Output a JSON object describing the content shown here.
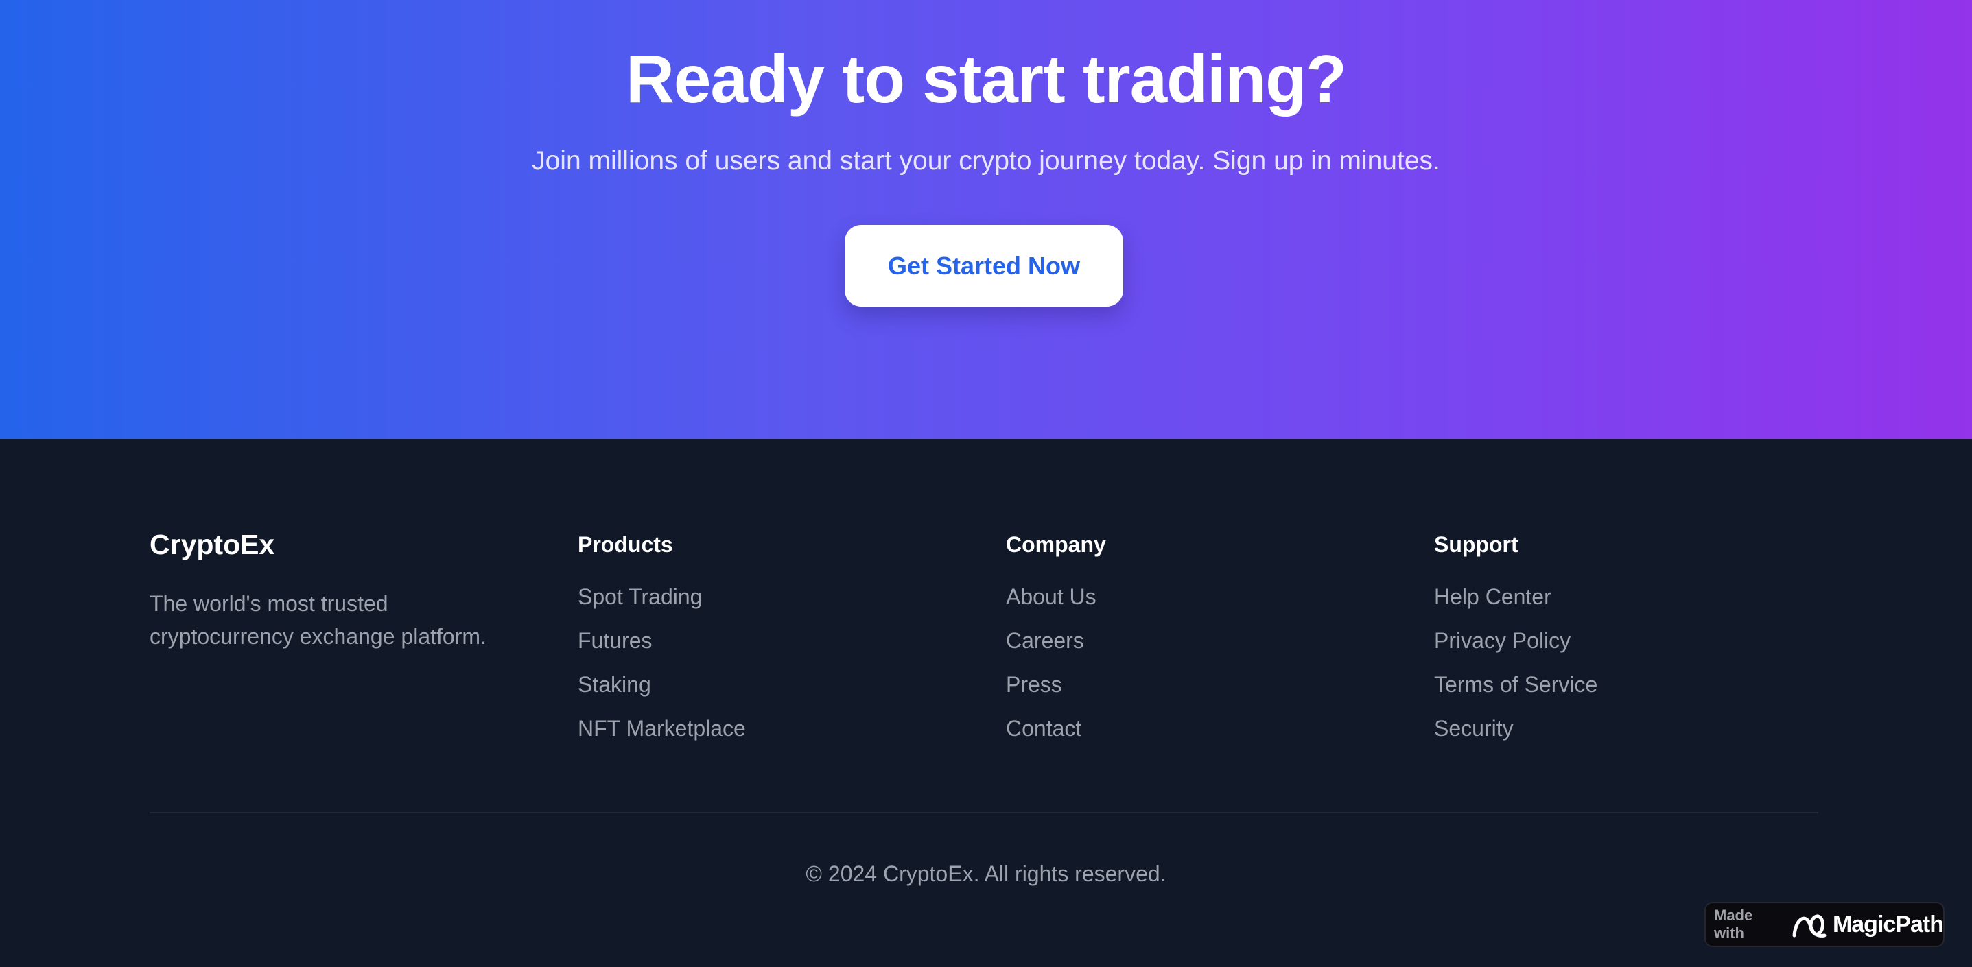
{
  "cta": {
    "title": "Ready to start trading?",
    "subtitle": "Join millions of users and start your crypto journey today. Sign up in minutes.",
    "button_label": "Get Started Now",
    "gradient_start": "#2563eb",
    "gradient_end": "#9333ea",
    "button_text_color": "#2563eb"
  },
  "footer": {
    "brand": {
      "name": "CryptoEx",
      "description": "The world's most trusted cryptocurrency exchange platform."
    },
    "columns": [
      {
        "heading": "Products",
        "links": [
          "Spot Trading",
          "Futures",
          "Staking",
          "NFT Marketplace"
        ]
      },
      {
        "heading": "Company",
        "links": [
          "About Us",
          "Careers",
          "Press",
          "Contact"
        ]
      },
      {
        "heading": "Support",
        "links": [
          "Help Center",
          "Privacy Policy",
          "Terms of Service",
          "Security"
        ]
      }
    ],
    "copyright": "© 2024 CryptoEx. All rights reserved.",
    "background": "#111827"
  },
  "badge": {
    "made_with": "Made with",
    "brand": "MagicPath",
    "icon": "magicpath-logo-icon"
  }
}
